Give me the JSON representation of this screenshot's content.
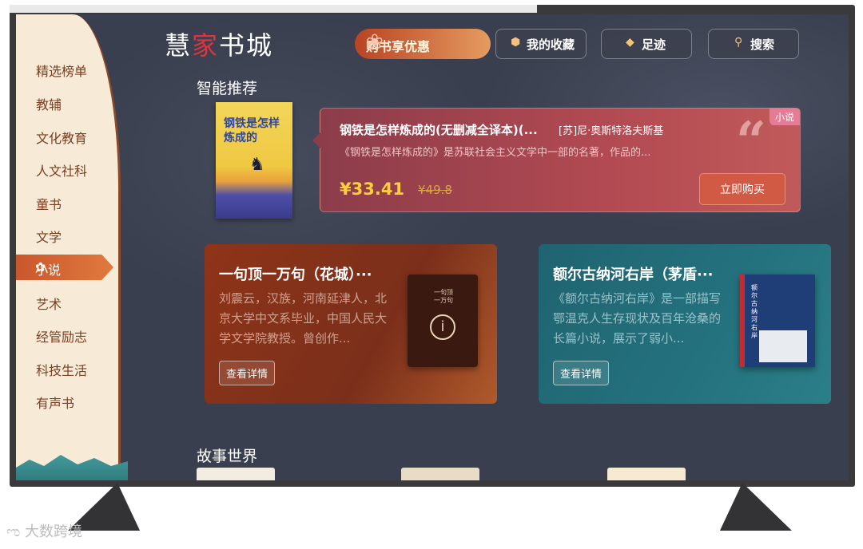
{
  "app": {
    "logo": {
      "part1": "慧",
      "part2": "家",
      "part3": "书城"
    }
  },
  "sidebar": {
    "items": [
      {
        "label": "精选榜单"
      },
      {
        "label": "教辅"
      },
      {
        "label": "文化教育"
      },
      {
        "label": "人文社科"
      },
      {
        "label": "童书"
      },
      {
        "label": "文学"
      },
      {
        "label": "小说",
        "active": true
      },
      {
        "label": "艺术"
      },
      {
        "label": "经管励志"
      },
      {
        "label": "科技生活"
      },
      {
        "label": "有声书"
      }
    ]
  },
  "header": {
    "promo_label": "购书享优惠",
    "favorites_label": "我的收藏",
    "history_label": "足迹",
    "search_label": "搜索"
  },
  "sections": {
    "recommend_title": "智能推荐",
    "story_title": "故事世界"
  },
  "featured": {
    "cover_title": "钢铁是怎样炼成的",
    "title": "钢铁是怎样炼成的(无删减全译本)(...",
    "author": "[苏]尼·奥斯特洛夫斯基",
    "description": "《钢铁是怎样炼成的》是苏联社会主义文学中一部的名著，作品的...",
    "price": "¥33.41",
    "original_price": "¥49.8",
    "category_badge": "小说",
    "buy_label": "立即购买"
  },
  "cards": [
    {
      "title": "一句顶一万句（花城）···",
      "description": "刘震云，汉族，河南延津人，北京大学中文系毕业，中国人民大学文学院教授。曾创作...",
      "cover_title": "一句顶一万句",
      "detail_label": "查看详情"
    },
    {
      "title": "额尔古纳河右岸（茅盾···",
      "description": "《额尔古纳河右岸》是一部描写鄂温克人生存现状及百年沧桑的长篇小说，展示了弱小...",
      "cover_title": "额尔古纳河右岸",
      "detail_label": "查看详情"
    }
  ],
  "watermark": "大数跨境",
  "icons": {
    "star": "star-icon",
    "favorites": "hexagon-icon",
    "history": "cube-icon",
    "search": "search-icon",
    "quote": "quote-icon",
    "info": "info-icon"
  },
  "colors": {
    "background": "#3a3f4f",
    "sidebar": "#f7ead7",
    "accent_orange": "#d05a44",
    "price_yellow": "#ffcf3c",
    "card_red": "#8e3419",
    "card_teal": "#1f6470"
  }
}
